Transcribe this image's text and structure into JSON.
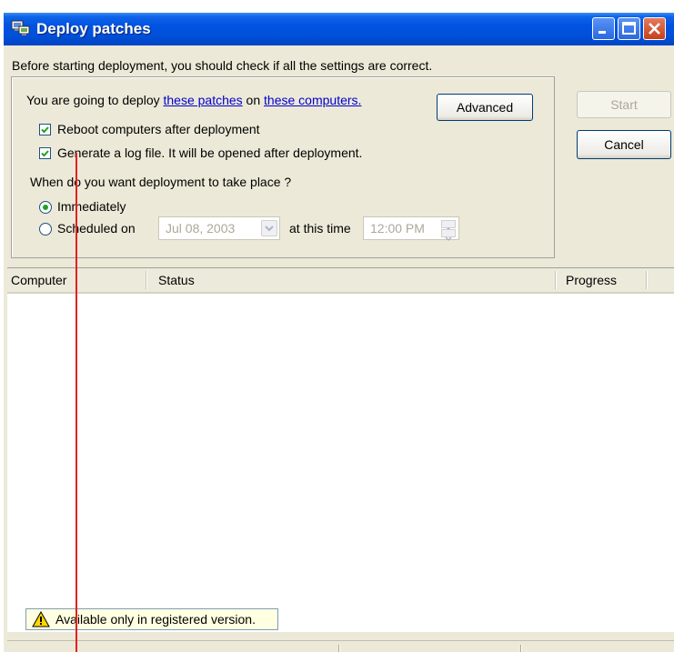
{
  "window": {
    "title": "Deploy patches",
    "icon": "deploy-patches-icon"
  },
  "intro_text": "Before starting deployment, you should check if all the settings are correct.",
  "deploy": {
    "prefix": "You are going to deploy ",
    "patches_link": "these patches",
    "middle": " on ",
    "computers_link": "these computers."
  },
  "buttons": {
    "advanced": "Advanced",
    "start": "Start",
    "cancel": "Cancel"
  },
  "options": {
    "reboot": {
      "label": "Reboot computers after deployment",
      "checked": true
    },
    "log": {
      "label": "Generate a log file. It will be opened after deployment.",
      "checked": true
    }
  },
  "schedule": {
    "question": "When do you want deployment to take place ?",
    "immediately": "Immediately",
    "scheduled": "Scheduled on",
    "selected": "Immediately",
    "date": "Jul  08, 2003",
    "at_time_label": "at this time",
    "time": "12:00 PM"
  },
  "table": {
    "columns": [
      "Computer",
      "Status",
      "Progress"
    ],
    "rows": []
  },
  "notice": "Available only in registered version.",
  "colors": {
    "title_bar": "#0053e1",
    "link": "#0000cc",
    "annotation_line": "#e32020"
  }
}
